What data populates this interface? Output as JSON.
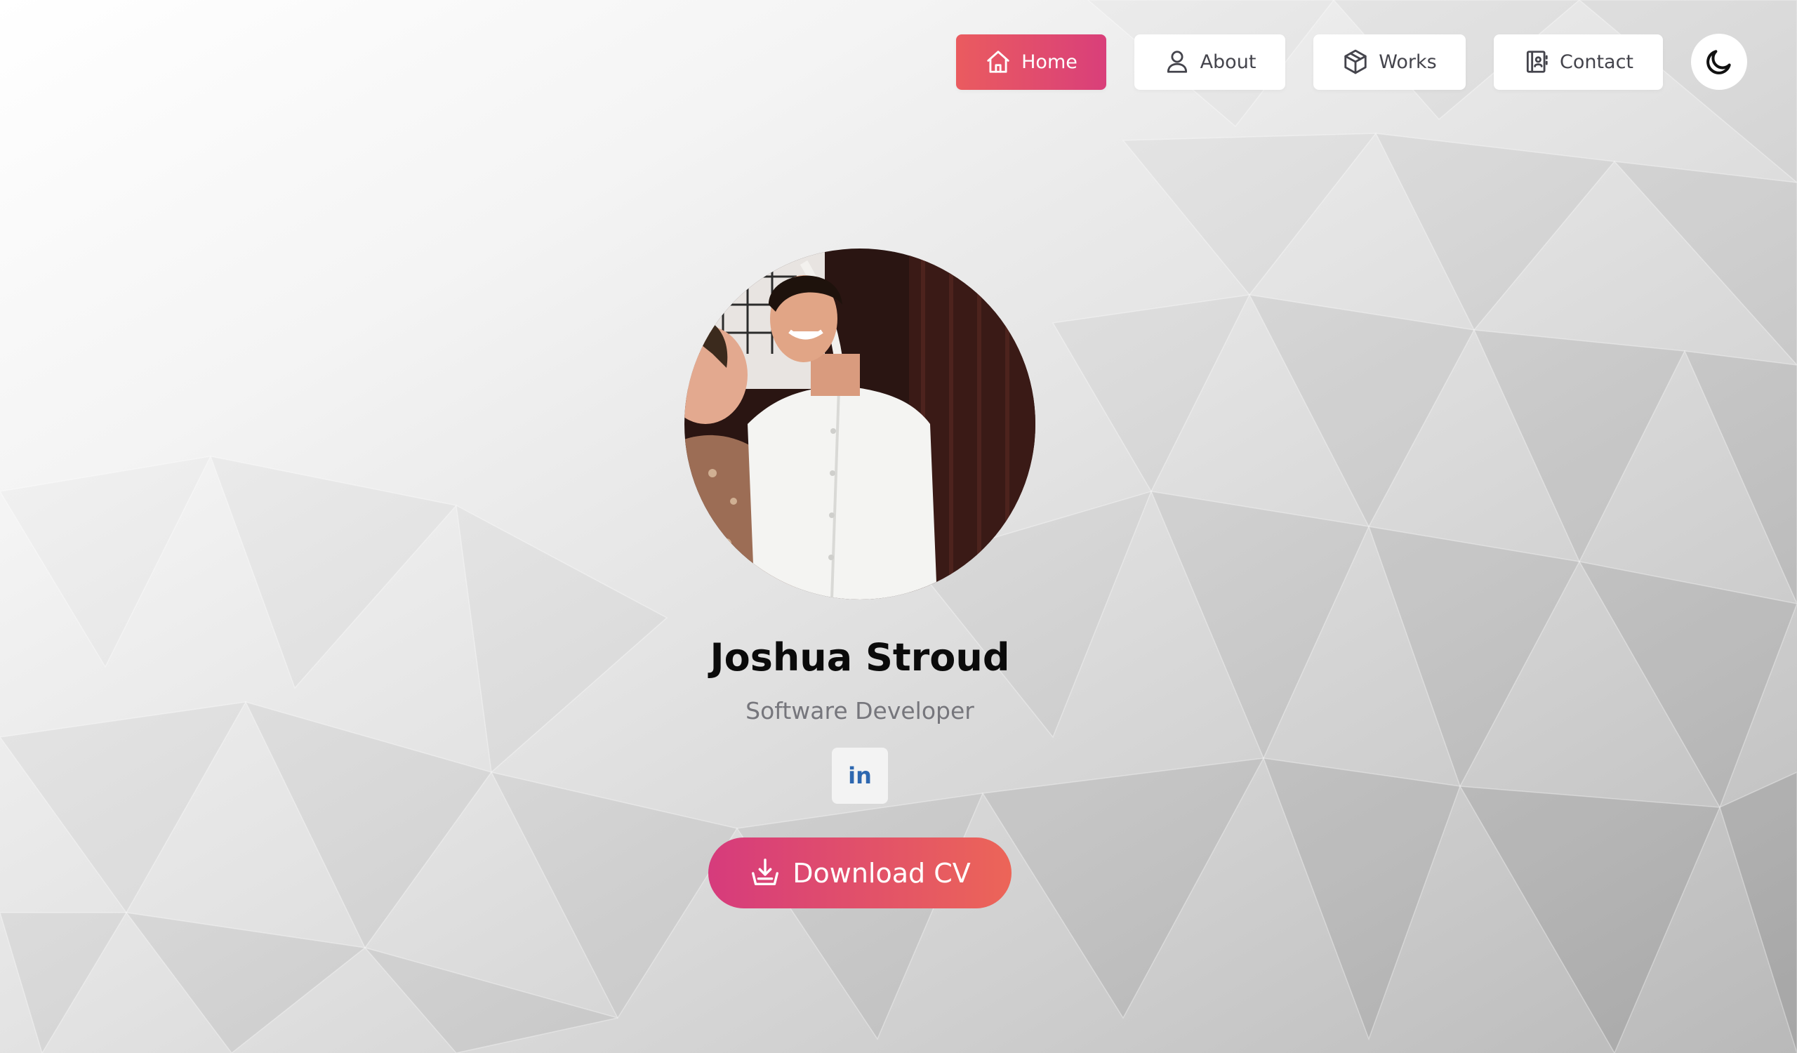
{
  "nav": {
    "items": [
      {
        "label": "Home",
        "icon": "home-icon",
        "active": true
      },
      {
        "label": "About",
        "icon": "user-icon",
        "active": false
      },
      {
        "label": "Works",
        "icon": "box-icon",
        "active": false
      },
      {
        "label": "Contact",
        "icon": "contact-book-icon",
        "active": false
      }
    ],
    "theme_toggle_icon": "moon-icon"
  },
  "profile": {
    "name": "Joshua Stroud",
    "role": "Software Developer",
    "social": [
      {
        "label": "in",
        "icon": "linkedin-icon"
      }
    ],
    "download_label": "Download CV",
    "download_icon": "download-icon"
  },
  "colors": {
    "accent_start": "#ea5b5f",
    "accent_end": "#d93f7a",
    "linkedin": "#2d67b0"
  }
}
